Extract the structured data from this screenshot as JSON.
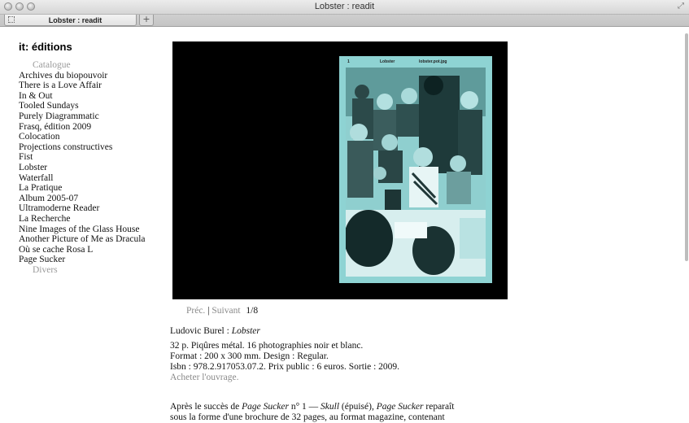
{
  "window": {
    "title": "Lobster : readit"
  },
  "tab": {
    "title": "Lobster : readit",
    "new_tab_label": "+"
  },
  "site": {
    "brand": "it: éditions"
  },
  "nav": {
    "catalogue_label": "Catalogue",
    "items": [
      "Archives du biopouvoir",
      "There is a Love Affair",
      "In & Out",
      "Tooled Sundays",
      "Purely Diagrammatic",
      "Frasq, édition 2009",
      "Colocation",
      "Projections constructives",
      "Fist",
      "Lobster",
      "Waterfall",
      "La Pratique",
      "Album 2005-07",
      "Ultramoderne Reader",
      "La Recherche",
      "Nine Images of the Glass House",
      "Another Picture of Me as Dracula",
      "Où se cache Rosa L",
      "Page Sucker"
    ],
    "divers_label": "Divers"
  },
  "cover": {
    "page_number": "1",
    "header_title": "Lobster",
    "header_file": "lobster.pot.jpg"
  },
  "pager": {
    "prev_label": "Préc.",
    "separator": "|",
    "next_label": "Suivant",
    "position": "1/8"
  },
  "book": {
    "author": "Ludovic Burel",
    "author_sep": " : ",
    "title": "Lobster",
    "line1": "32 p. Piqûres métal. 16 photographies noir et blanc.",
    "line2": "Format : 200 x 300 mm. Design : Regular.",
    "line3": "Isbn : 978.2.917053.07.2. Prix public : 6 euros. Sortie : 2009.",
    "buy_label": "Acheter l'ouvrage."
  },
  "description": {
    "part1": "Après le succès de ",
    "em1": "Page Sucker",
    "part2": " n° 1 — ",
    "em2": "Skull",
    "part3": " (épuisé), ",
    "em3": "Page Sucker",
    "part4": " reparaît",
    "line2": "sous la forme d'une brochure de 32 pages, au format magazine, contenant"
  }
}
